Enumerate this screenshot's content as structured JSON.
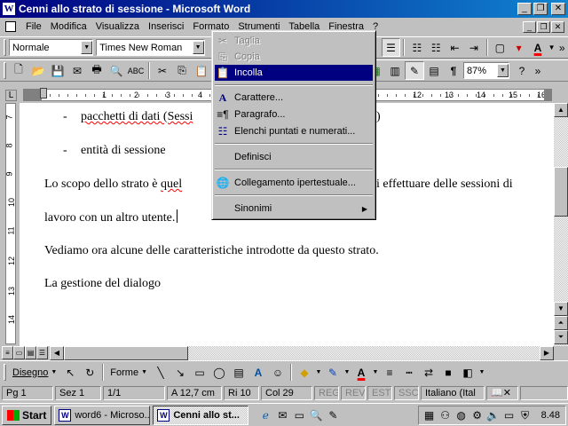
{
  "window": {
    "title": "Cenni allo strato di sessione - Microsoft Word"
  },
  "title_buttons": {
    "minimize": "_",
    "restore": "❐",
    "close": "✕"
  },
  "menu": [
    "File",
    "Modifica",
    "Visualizza",
    "Inserisci",
    "Formato",
    "Strumenti",
    "Tabella",
    "Finestra",
    "?"
  ],
  "formatting": {
    "style": "Normale",
    "font": "Times New Roman",
    "zoom": "87%"
  },
  "ruler": {
    "h_numbers": [
      "1",
      "2",
      "3",
      "4",
      "5",
      "12",
      "13",
      "14",
      "15",
      "16"
    ],
    "v_numbers": [
      "7",
      "8",
      "9",
      "10",
      "11",
      "12",
      "13",
      "14"
    ]
  },
  "document": {
    "line1_dash": "-",
    "line1_text": "pacchetti di dati (Sessi",
    "line1_tail": ")",
    "line2_dash": "-",
    "line2_text": "entità di sessione",
    "line3_a": "Lo scopo dello strato è",
    "line3_b": "quel",
    "line3_c": "i effettuare delle sessioni di",
    "line4": "lavoro con un altro utente.",
    "line5": "Vediamo ora alcune delle caratteristiche introdotte da questo strato.",
    "line6": "La gestione del dialogo"
  },
  "context_menu": {
    "cut": "Taglia",
    "copy": "Copia",
    "paste": "Incolla",
    "font": "Carattere...",
    "paragraph": "Paragrafo...",
    "bullets": "Elenchi puntati e numerati...",
    "define": "Definisci",
    "hyperlink": "Collegamento ipertestuale...",
    "synonyms": "Sinonimi"
  },
  "drawing": {
    "draw": "Disegno",
    "autoshapes": "Forme"
  },
  "status": {
    "page": "Pg 1",
    "section": "Sez 1",
    "pages": "1/1",
    "position": "A 12,7 cm",
    "line": "Ri 10",
    "column": "Col 29",
    "rec": "REG",
    "rev": "REV",
    "ext": "EST",
    "ovr": "SSC",
    "language": "Italiano (Ital"
  },
  "taskbar": {
    "start": "Start",
    "task1": "word6 - Microso...",
    "task2": "Cenni allo st...",
    "clock": "8.48"
  }
}
